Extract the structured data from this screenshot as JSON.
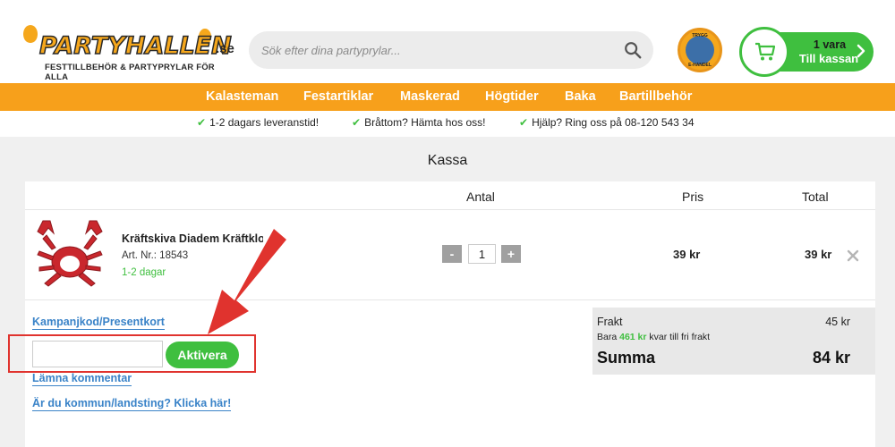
{
  "header": {
    "logo_text": "PARTYHALLEN",
    "logo_tld": ".se",
    "logo_tagline": "FESTTILLBEHÖR & PARTYPRYLAR FÖR ALLA",
    "search_placeholder": "Sök efter dina partyprylar...",
    "trust_badge_top": "TRYGG",
    "trust_badge_bottom": "E-HANDEL",
    "cart_count": "1 vara",
    "cart_label": "Till kassan"
  },
  "nav": {
    "items": [
      "Kalasteman",
      "Festartiklar",
      "Maskerad",
      "Högtider",
      "Baka",
      "Bartillbehör"
    ]
  },
  "usp": {
    "items": [
      "1-2 dagars leveranstid!",
      "Bråttom? Hämta hos oss!",
      "Hjälp? Ring oss på 08-120 543 34"
    ]
  },
  "page": {
    "title": "Kassa"
  },
  "table": {
    "headers": {
      "qty": "Antal",
      "price": "Pris",
      "total": "Total"
    }
  },
  "product": {
    "name": "Kräftskiva Diadem Kräftklo",
    "art_no": "Art. Nr.: 18543",
    "stock": "1-2 dagar",
    "qty": "1",
    "qty_minus": "-",
    "qty_plus": "+",
    "price": "39 kr",
    "total": "39 kr"
  },
  "actions": {
    "coupon_link": "Kampanjkod/Presentkort",
    "coupon_placeholder": "",
    "activate_label": "Aktivera",
    "comment_link": "Lämna kommentar",
    "municipality_link": "Är du kommun/landsting? Klicka här!"
  },
  "summary": {
    "shipping_label": "Frakt",
    "shipping_value": "45 kr",
    "free_prefix": "Bara",
    "free_amount": "461 kr",
    "free_suffix": "kvar till fri frakt",
    "sum_label": "Summa",
    "sum_value": "84 kr"
  },
  "colors": {
    "brand_orange": "#f7a01b",
    "brand_green": "#3fbf3f",
    "link_blue": "#3a83c8",
    "annotation_red": "#e0332e"
  }
}
